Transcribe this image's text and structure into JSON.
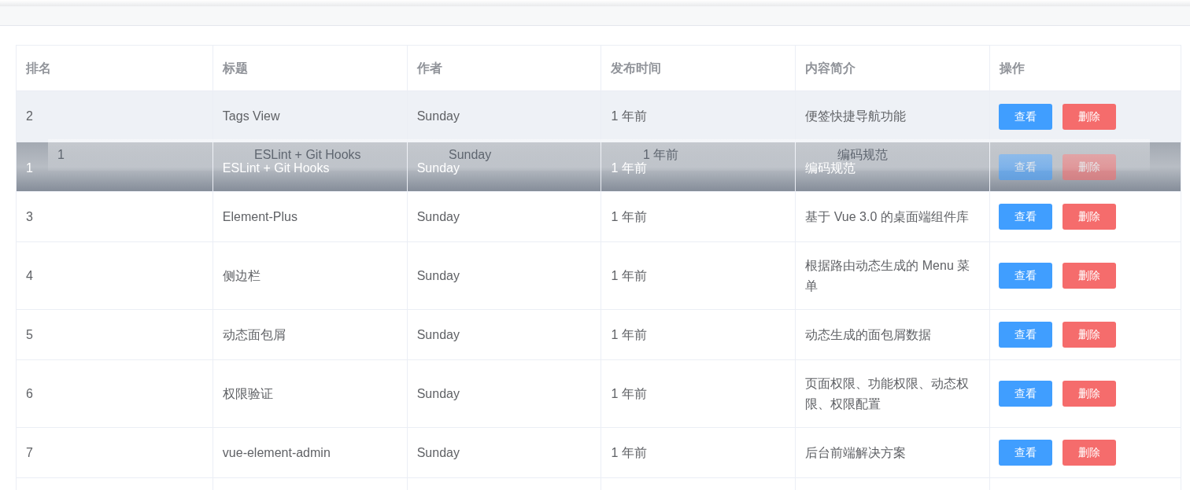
{
  "table": {
    "columns": [
      "排名",
      "标题",
      "作者",
      "发布时间",
      "内容简介",
      "操作"
    ],
    "rows": [
      {
        "rank": "2",
        "title": "Tags View",
        "author": "Sunday",
        "time": "1 年前",
        "summary": "便签快捷导航功能",
        "actions": [
          "查看",
          "删除"
        ],
        "highlighted": true,
        "dragging": false
      },
      {
        "rank": "1",
        "title": "ESLint + Git Hooks",
        "author": "Sunday",
        "time": "1 年前",
        "summary": "编码规范",
        "actions": [
          "查看",
          "删除"
        ],
        "highlighted": false,
        "dragging": true
      },
      {
        "rank": "3",
        "title": "Element-Plus",
        "author": "Sunday",
        "time": "1 年前",
        "summary": "基于 Vue 3.0 的桌面端组件库",
        "actions": [
          "查看",
          "删除"
        ],
        "highlighted": false,
        "dragging": false
      },
      {
        "rank": "4",
        "title": "侧边栏",
        "author": "Sunday",
        "time": "1 年前",
        "summary": "根据路由动态生成的 Menu 菜单",
        "actions": [
          "查看",
          "删除"
        ],
        "highlighted": false,
        "dragging": false
      },
      {
        "rank": "5",
        "title": "动态面包屑",
        "author": "Sunday",
        "time": "1 年前",
        "summary": "动态生成的面包屑数据",
        "actions": [
          "查看",
          "删除"
        ],
        "highlighted": false,
        "dragging": false
      },
      {
        "rank": "6",
        "title": "权限验证",
        "author": "Sunday",
        "time": "1 年前",
        "summary": "页面权限、功能权限、动态权限、权限配置",
        "actions": [
          "查看",
          "删除"
        ],
        "highlighted": false,
        "dragging": false
      },
      {
        "rank": "7",
        "title": "vue-element-admin",
        "author": "Sunday",
        "time": "1 年前",
        "summary": "后台前端解决方案",
        "actions": [
          "查看",
          "删除"
        ],
        "highlighted": false,
        "dragging": false
      }
    ],
    "drag_ghost": {
      "rank": "1",
      "title": "ESLint + Git Hooks",
      "author": "Sunday",
      "time": "1 年前",
      "summary": "编码规范"
    }
  }
}
